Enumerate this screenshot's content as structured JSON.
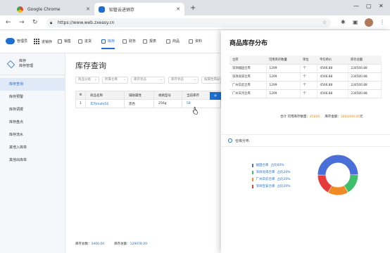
{
  "browser": {
    "tabs": [
      {
        "label": "Google Chrome",
        "active": false
      },
      {
        "label": "知管云进销存",
        "active": true
      }
    ],
    "url": "https://www.web.zxeasy.cn"
  },
  "app": {
    "logo_label": "管理员",
    "menu": [
      {
        "label": "进销存",
        "active": false
      },
      {
        "label": "销售",
        "active": false
      },
      {
        "label": "进货",
        "active": false
      },
      {
        "label": "库存",
        "active": true
      },
      {
        "label": "财务",
        "active": false
      },
      {
        "label": "报表",
        "active": false
      },
      {
        "label": "商品",
        "active": false
      },
      {
        "label": "资料",
        "active": false
      }
    ]
  },
  "sidebar": {
    "header_line1": "库存",
    "header_line2": "库存管理",
    "items": [
      {
        "label": "库存查询",
        "active": true
      },
      {
        "label": "库存预警",
        "active": false
      },
      {
        "label": "库存调拨",
        "active": false
      },
      {
        "label": "库存盘点",
        "active": false
      },
      {
        "label": "库存流水",
        "active": false
      },
      {
        "label": "其他入库单",
        "active": false
      },
      {
        "label": "其他出库单",
        "active": false
      }
    ]
  },
  "main": {
    "title": "库存查询",
    "filters": [
      "商品分类",
      "所属仓库",
      "库存状态",
      "库存状态",
      "按属性筛分",
      "批库状态"
    ],
    "columns": [
      "商品名称",
      "辅助属性",
      "规格型号",
      "当前库存"
    ],
    "rows": [
      {
        "no": "1",
        "name": "华为mate50",
        "attr": "黑色",
        "spec": "256g",
        "stock": "58"
      }
    ],
    "footer": {
      "total_qty_label": "库存总数：",
      "total_qty": "3400.00",
      "total_amount_label": "库存总额：",
      "total_amount": "129078.00"
    }
  },
  "panel": {
    "title": "商品库存分布",
    "columns": [
      "仓库",
      "可用库存数量",
      "单位",
      "平均单价",
      "库存总额"
    ],
    "rows": [
      {
        "warehouse": "深圳福田仓库",
        "qty": "1299",
        "unit": "个",
        "price": "4566.88",
        "total": "234500.88"
      },
      {
        "warehouse": "深圳龙岗仓库",
        "qty": "1299",
        "unit": "个",
        "price": "4566.88",
        "total": "234500.88"
      },
      {
        "warehouse": "广州白云仓库",
        "qty": "1299",
        "unit": "个",
        "price": "4566.88",
        "total": "234500.88"
      },
      {
        "warehouse": "广州天河仓库",
        "qty": "1299",
        "unit": "个",
        "price": "4566.88",
        "total": "234500.88"
      }
    ],
    "totals": {
      "label": "合计",
      "qty_label": "可用库存数量：",
      "qty": "45600",
      "amount_label": "库存金额：",
      "amount": "1804400.00",
      "amount_unit": "元"
    },
    "dist_title": "仓库分布",
    "distribution": [
      {
        "name": "福田仓库",
        "pct_text": "占比60%",
        "color": "#4a6fd8",
        "value": 60
      },
      {
        "name": "深圳龙岗仓库",
        "pct_text": "占比20%",
        "color": "#3fbf6a",
        "value": 20
      },
      {
        "name": "广州白云仓库",
        "pct_text": "占比20%",
        "color": "#f08a24",
        "value": 20
      },
      {
        "name": "深圳宝安仓库",
        "pct_text": "占比20%",
        "color": "#e63b3b",
        "value": 20
      }
    ]
  }
}
